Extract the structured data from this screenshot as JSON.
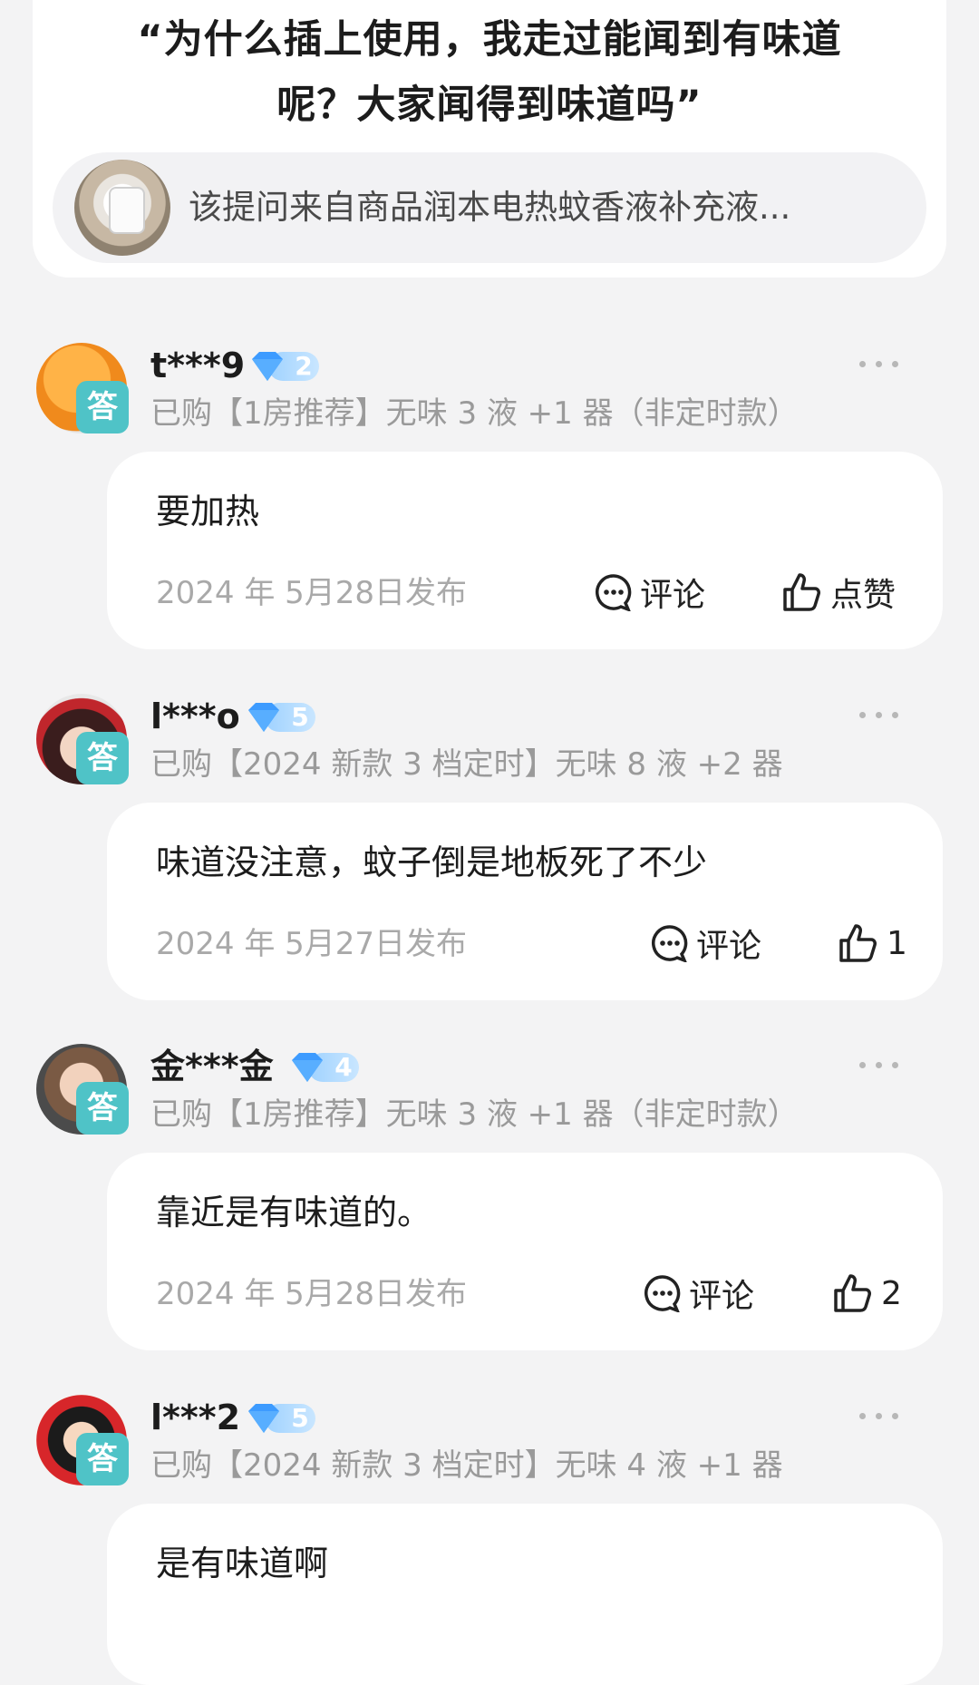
{
  "question": {
    "text_line1": "“为什么插上使用，我走过能闻到有味道",
    "text_line2": "呢？大家闻得到味道吗”",
    "source": "该提问来自商品润本电热蚊香液补充液..."
  },
  "answers": [
    {
      "username": "t***9",
      "level": "2",
      "tag": "答",
      "purchase": "已购【1房推荐】无味 3 液 +1 器（非定时款）",
      "content": "要加热",
      "date": "2024 年 5月28日发布",
      "comment_label": "评论",
      "like_label": "点赞"
    },
    {
      "username": "l***o",
      "level": "5",
      "tag": "答",
      "purchase": "已购【2024 新款 3 档定时】无味 8 液 +2 器",
      "content": "味道没注意，蚊子倒是地板死了不少",
      "date": "2024 年 5月27日发布",
      "comment_label": "评论",
      "like_label": "1"
    },
    {
      "username": "金***金",
      "level": "4",
      "tag": "答",
      "purchase": "已购【1房推荐】无味 3 液 +1 器（非定时款）",
      "content": "靠近是有味道的。",
      "date": "2024 年 5月28日发布",
      "comment_label": "评论",
      "like_label": "2"
    },
    {
      "username": "l***2",
      "level": "5",
      "tag": "答",
      "purchase": "已购【2024 新款 3 档定时】无味 4 液 +1 器",
      "content": "是有味道啊"
    }
  ],
  "colors": {
    "background": "#f3f3f4",
    "card": "#ffffff",
    "answer_tag": "#4fc3c7",
    "level_badge": "#6fb6ff",
    "muted_text": "#9a9a9a"
  }
}
